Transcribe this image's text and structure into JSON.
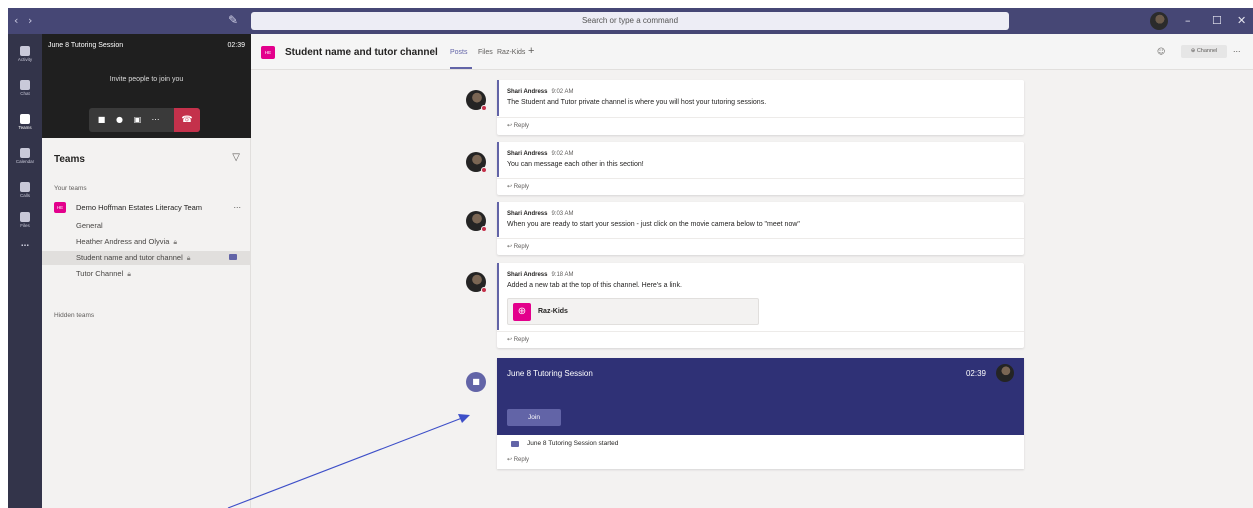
{
  "titlebar": {
    "back_icon": "chevron-left-icon",
    "forward_icon": "chevron-right-icon",
    "compose_icon": "compose-icon",
    "search_placeholder": "Search or type a command",
    "window_controls": [
      "–",
      "☐",
      "✕"
    ]
  },
  "rail": {
    "items": [
      {
        "label": "Activity",
        "icon": "bell-icon"
      },
      {
        "label": "Chat",
        "icon": "chat-icon"
      },
      {
        "label": "Teams",
        "icon": "teams-icon"
      },
      {
        "label": "Calendar",
        "icon": "calendar-icon"
      },
      {
        "label": "Calls",
        "icon": "phone-icon"
      },
      {
        "label": "Files",
        "icon": "file-icon"
      }
    ],
    "more": "..."
  },
  "meeting_window": {
    "title": "June 8 Tutoring Session",
    "time": "02:39",
    "invite": "Invite people to join you"
  },
  "teams_panel": {
    "heading": "Teams",
    "your_teams": "Your teams",
    "team": {
      "badge": "HE",
      "name": "Demo Hoffman Estates Literacy Team",
      "more": "..."
    },
    "channels": [
      {
        "name": "General",
        "private": false
      },
      {
        "name": "Heather Andress and Olyvia",
        "private": true
      },
      {
        "name": "Student name and tutor channel",
        "private": true
      },
      {
        "name": "Tutor Channel",
        "private": true
      }
    ],
    "hidden_teams": "Hidden teams"
  },
  "channel_header": {
    "badge": "HE",
    "title": "Student name and tutor channel",
    "tabs": [
      "Posts",
      "Files",
      "Raz-Kids"
    ],
    "add_tab": "+",
    "channel_pill": "⊕ Channel",
    "more": "..."
  },
  "posts": [
    {
      "author": "Shari Andress",
      "time": "9:02 AM",
      "body": "The Student and Tutor private channel is where you will host your tutoring sessions.",
      "reply": "↩ Reply"
    },
    {
      "author": "Shari Andress",
      "time": "9:02 AM",
      "body": "You can message each other in this section!",
      "reply": "↩ Reply"
    },
    {
      "author": "Shari Andress",
      "time": "9:03 AM",
      "body": "When you are ready to start your session - just click on the movie camera below to \"meet now\"",
      "reply": "↩ Reply"
    },
    {
      "author": "Shari Andress",
      "time": "9:18 AM",
      "body": "Added a new tab at the top of this channel. Here's a link.",
      "link": "Raz-Kids",
      "reply": "↩ Reply"
    }
  ],
  "meeting_card": {
    "title": "June 8 Tutoring Session",
    "time": "02:39",
    "join": "Join",
    "started": "June 8 Tutoring Session started",
    "reply": "↩ Reply"
  },
  "colors": {
    "titlebar": "#464775",
    "rail": "#33344a",
    "accent": "#6264a7",
    "team_badge": "#e3008c",
    "hangup": "#c4314b",
    "meeting_card": "#2f3176"
  }
}
